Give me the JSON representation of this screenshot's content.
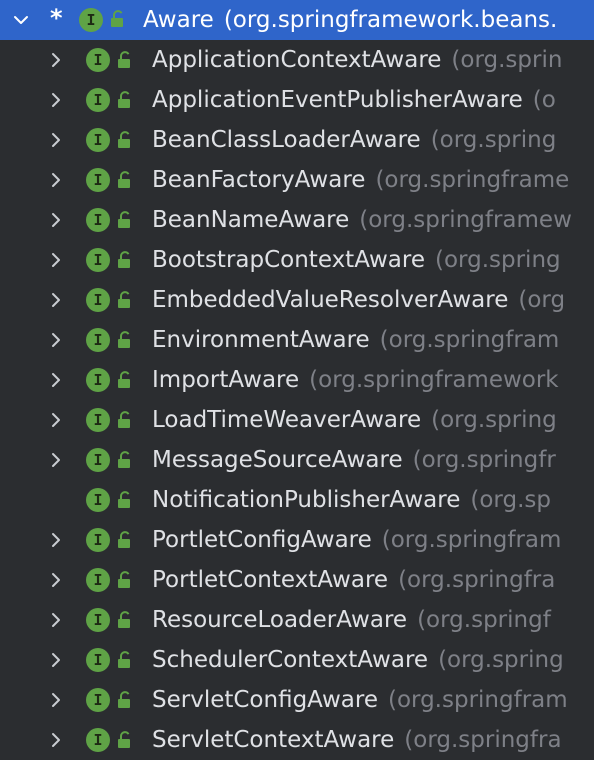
{
  "colors": {
    "background": "#2b2d30",
    "selection": "#2f65ca",
    "interface_badge": "#5fa346",
    "class_name": "#dfe1e5",
    "package": "#7e8087"
  },
  "icons": {
    "expanded_chevron": "chevron-down-icon",
    "collapsed_chevron": "chevron-right-icon",
    "interface_badge": "interface-icon",
    "visibility": "public-lock-icon"
  },
  "tree": {
    "root": {
      "modified_marker": "*",
      "badge_letter": "I",
      "name": "Aware",
      "package": "(org.springframework.beans.",
      "expanded": true,
      "selected": true
    },
    "children": [
      {
        "badge_letter": "I",
        "name": "ApplicationContextAware",
        "package": "(org.sprin",
        "has_children": true
      },
      {
        "badge_letter": "I",
        "name": "ApplicationEventPublisherAware",
        "package": "(o",
        "has_children": true
      },
      {
        "badge_letter": "I",
        "name": "BeanClassLoaderAware",
        "package": "(org.spring",
        "has_children": true
      },
      {
        "badge_letter": "I",
        "name": "BeanFactoryAware",
        "package": "(org.springframe",
        "has_children": true
      },
      {
        "badge_letter": "I",
        "name": "BeanNameAware",
        "package": "(org.springframew",
        "has_children": true
      },
      {
        "badge_letter": "I",
        "name": "BootstrapContextAware",
        "package": "(org.spring",
        "has_children": true
      },
      {
        "badge_letter": "I",
        "name": "EmbeddedValueResolverAware",
        "package": "(org",
        "has_children": true
      },
      {
        "badge_letter": "I",
        "name": "EnvironmentAware",
        "package": "(org.springfram",
        "has_children": true
      },
      {
        "badge_letter": "I",
        "name": "ImportAware",
        "package": "(org.springframework",
        "has_children": true
      },
      {
        "badge_letter": "I",
        "name": "LoadTimeWeaverAware",
        "package": "(org.spring",
        "has_children": true
      },
      {
        "badge_letter": "I",
        "name": "MessageSourceAware",
        "package": "(org.springfr",
        "has_children": true
      },
      {
        "badge_letter": "I",
        "name": "NotificationPublisherAware",
        "package": "(org.sp",
        "has_children": false
      },
      {
        "badge_letter": "I",
        "name": "PortletConfigAware",
        "package": "(org.springfram",
        "has_children": true
      },
      {
        "badge_letter": "I",
        "name": "PortletContextAware",
        "package": "(org.springfra",
        "has_children": true
      },
      {
        "badge_letter": "I",
        "name": "ResourceLoaderAware",
        "package": "(org.springf",
        "has_children": true
      },
      {
        "badge_letter": "I",
        "name": "SchedulerContextAware",
        "package": "(org.spring",
        "has_children": true
      },
      {
        "badge_letter": "I",
        "name": "ServletConfigAware",
        "package": "(org.springfram",
        "has_children": true
      },
      {
        "badge_letter": "I",
        "name": "ServletContextAware",
        "package": "(org.springfra",
        "has_children": true
      }
    ]
  }
}
